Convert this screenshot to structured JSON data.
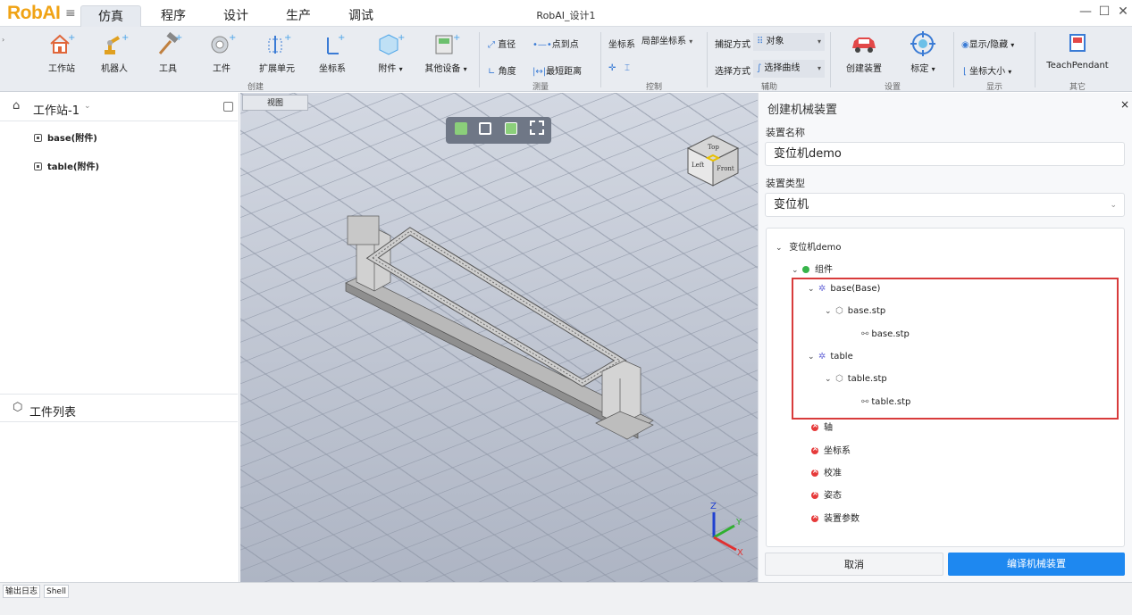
{
  "app": {
    "logo": "RobAI",
    "title": "RobAI_设计1",
    "minimize": "—",
    "maximize": "☐",
    "close": "✕"
  },
  "tabs": [
    {
      "label": "仿真"
    },
    {
      "label": "程序"
    },
    {
      "label": "设计"
    },
    {
      "label": "生产"
    },
    {
      "label": "调试"
    }
  ],
  "ribbon": {
    "create": {
      "label": "创建",
      "items": [
        "工作站",
        "机器人",
        "工具",
        "工件",
        "扩展单元",
        "坐标系",
        "附件",
        "其他设备"
      ]
    },
    "measure": {
      "label": "测量",
      "items": [
        "直径",
        "点到点",
        "角度",
        "最短距离"
      ]
    },
    "control": {
      "label": "控制",
      "coord_label": "坐标系",
      "coord_value": "局部坐标系"
    },
    "assist": {
      "label": "辅助",
      "capture_label": "捕捉方式",
      "capture_value": "对象",
      "select_label": "选择方式",
      "select_value": "选择曲线"
    },
    "setup": {
      "label": "设置",
      "items": [
        "创建装置",
        "标定"
      ]
    },
    "display": {
      "label": "显示",
      "show_hide": "显示/隐藏",
      "coord_size": "坐标大小"
    },
    "other": {
      "label": "其它",
      "teach": "TeachPendant"
    }
  },
  "left": {
    "station": "工作站-1",
    "items": [
      {
        "label": "base(附件)"
      },
      {
        "label": "table(附件)"
      }
    ],
    "parts_title": "工件列表"
  },
  "viewport": {
    "tab": "视图",
    "cube_top": "Top",
    "cube_left": "Left",
    "cube_front": "Front",
    "axis_x": "X",
    "axis_y": "Y",
    "axis_z": "Z"
  },
  "right": {
    "title": "创建机械装置",
    "name_label": "装置名称",
    "name_value": "变位机demo",
    "type_label": "装置类型",
    "type_value": "变位机",
    "tree": {
      "root": "变位机demo",
      "components": "组件",
      "base": "base(Base)",
      "base_stp": "base.stp",
      "base_stp_child": "base.stp",
      "table": "table",
      "table_stp": "table.stp",
      "table_stp_child": "table.stp",
      "axis": "轴",
      "coords": "坐标系",
      "calib": "校准",
      "pose": "姿态",
      "params": "装置参数"
    },
    "cancel": "取消",
    "compile": "编译机械装置"
  },
  "status": {
    "log": "输出日志",
    "shell": "Shell"
  },
  "colors": {
    "accent": "#1e88f0",
    "logo": "#f0a315",
    "highlight": "#d83b3b"
  }
}
